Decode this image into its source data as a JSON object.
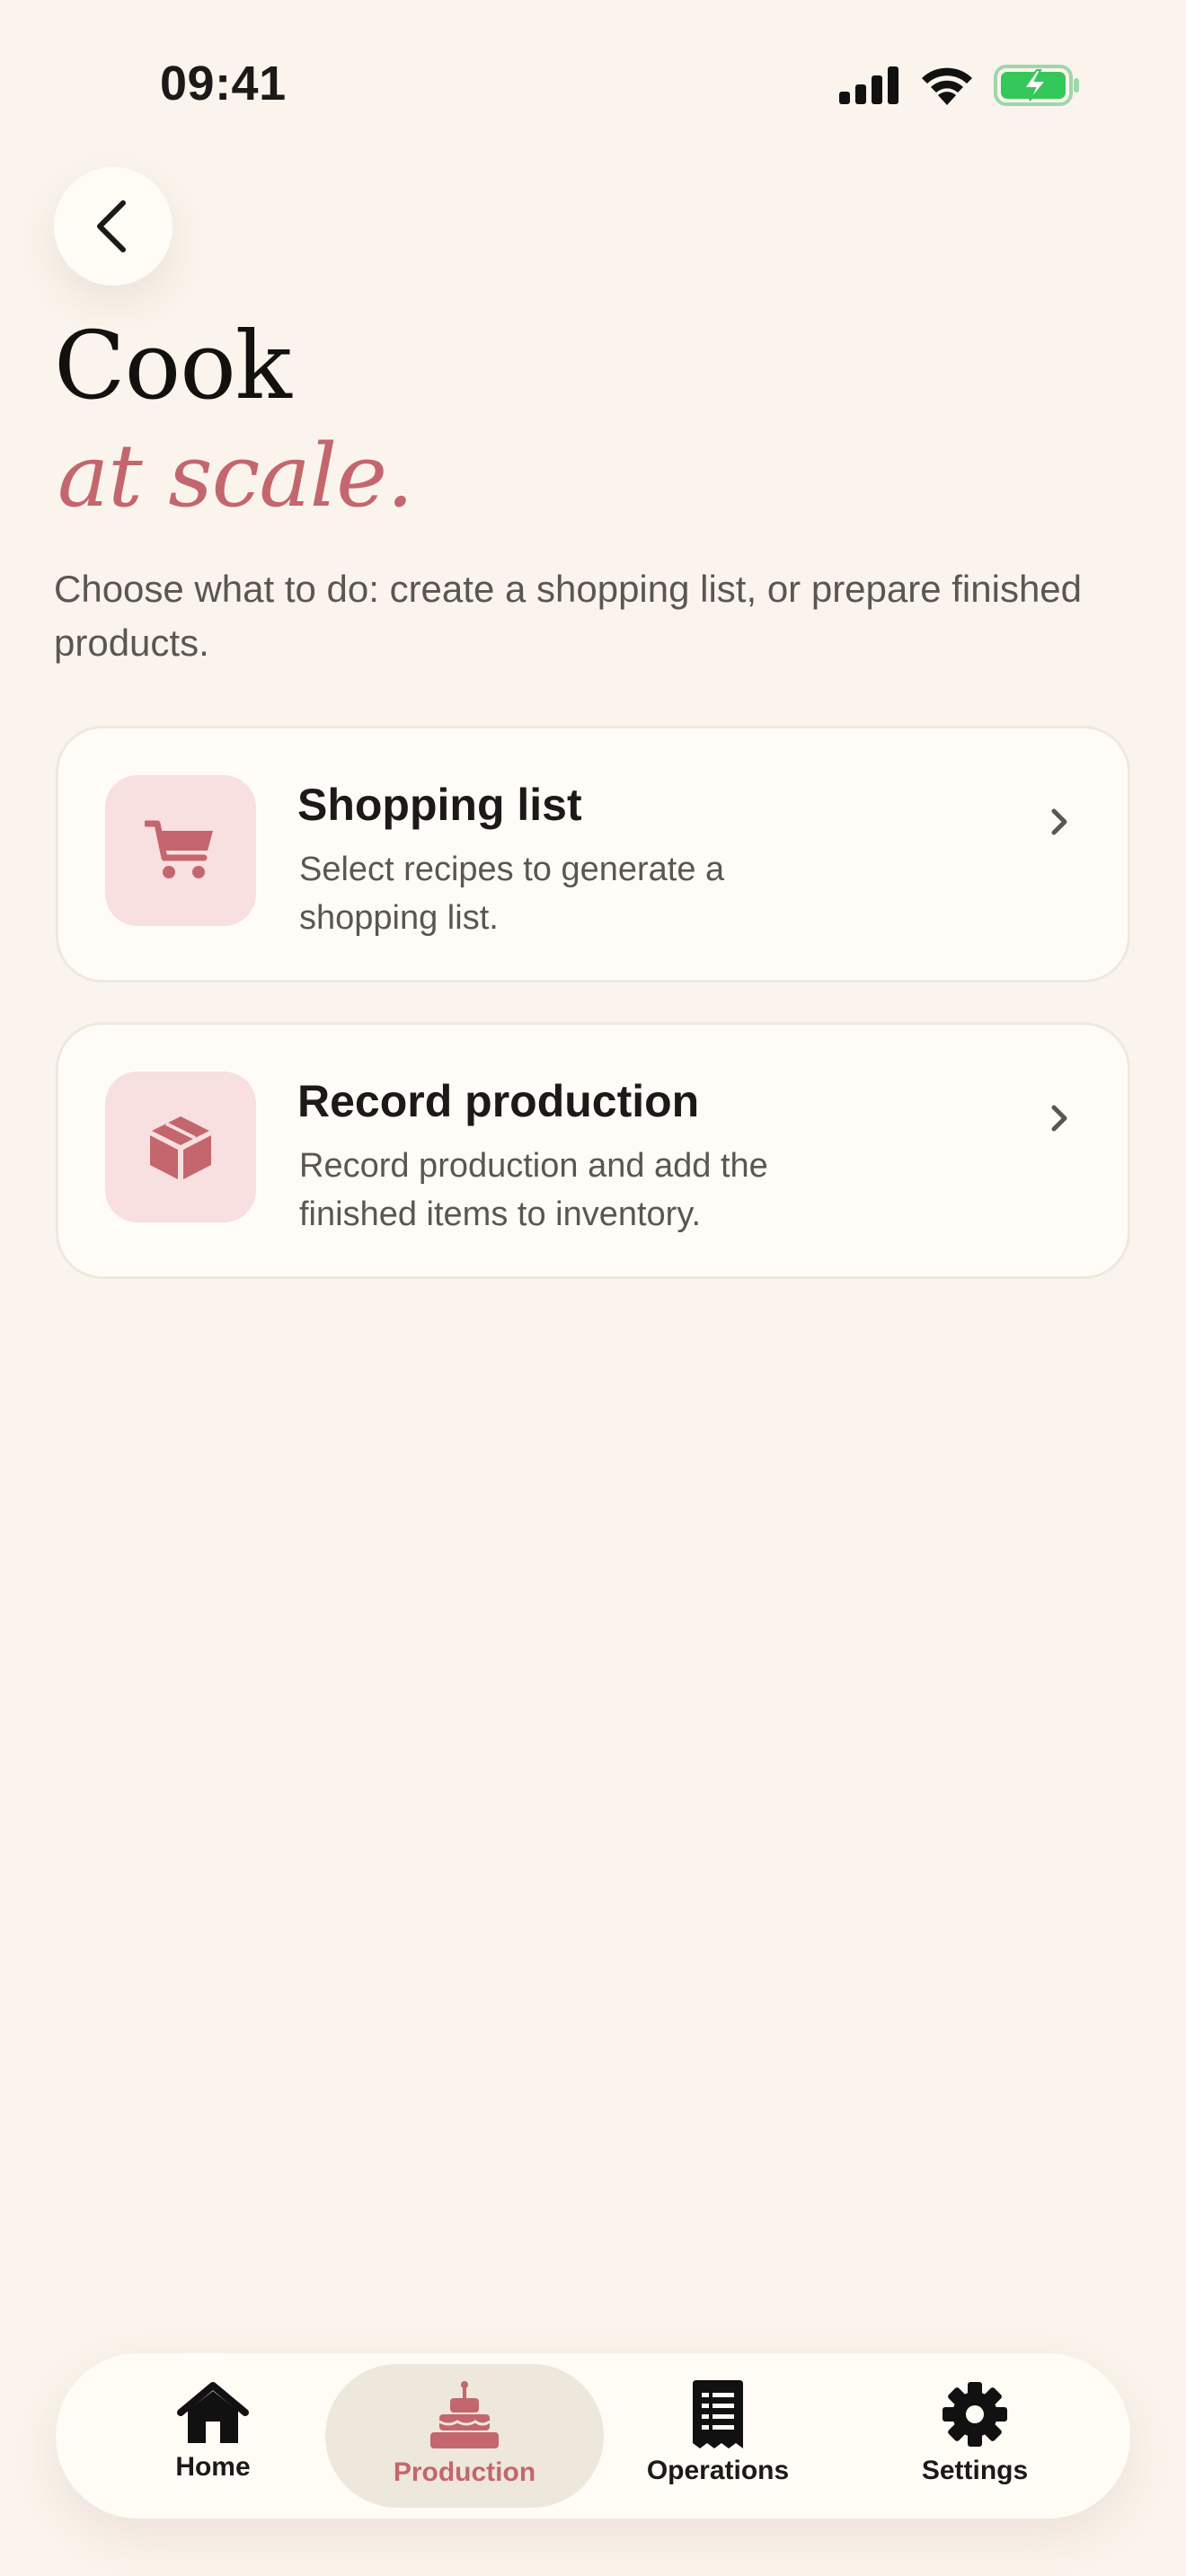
{
  "status_bar": {
    "time": "09:41",
    "icons": [
      "cellular-signal-icon",
      "wifi-icon",
      "battery-charging-icon"
    ]
  },
  "header": {
    "back_icon": "chevron-left-icon",
    "title": "Cook",
    "title_accent": "at scale.",
    "subtitle": "Choose what to do: create a shopping list, or prepare finished products."
  },
  "options": [
    {
      "icon": "cart-icon",
      "title": "Shopping list",
      "description": "Select recipes to generate a shopping list."
    },
    {
      "icon": "box-icon",
      "title": "Record production",
      "description": "Record production and add the finished items to inventory."
    }
  ],
  "tabbar": {
    "active": "Production",
    "tabs": [
      {
        "label": "Home",
        "icon": "home-icon"
      },
      {
        "label": "Production",
        "icon": "cake-icon"
      },
      {
        "label": "Operations",
        "icon": "receipt-icon"
      },
      {
        "label": "Settings",
        "icon": "gear-icon"
      }
    ]
  },
  "colors": {
    "background": "#faf4ec",
    "accent": "#c4666d",
    "icon_tile": "#f8dfe0",
    "battery": "#34c759"
  }
}
